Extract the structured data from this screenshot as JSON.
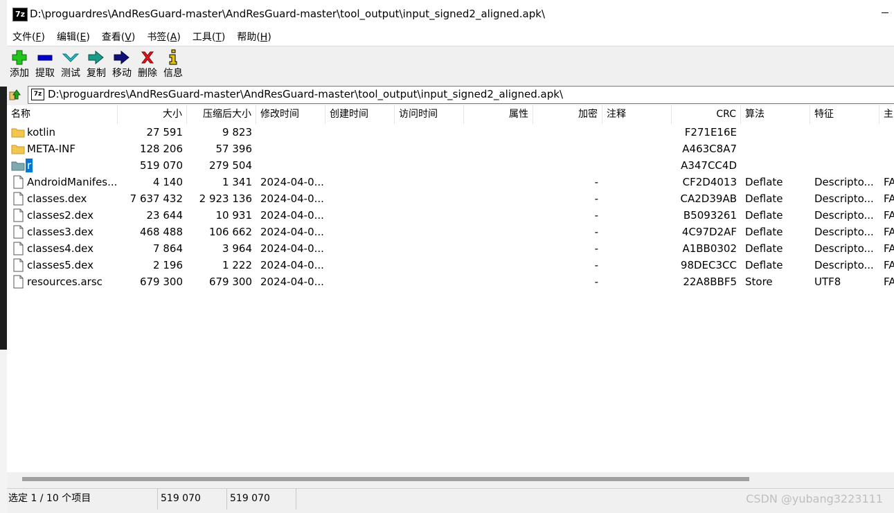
{
  "window": {
    "title": "D:\\proguardres\\AndResGuard-master\\AndResGuard-master\\tool_output\\input_signed2_aligned.apk\\",
    "icon_text": "7z"
  },
  "menu": [
    {
      "text": "文件(",
      "key": "F",
      "end": ")"
    },
    {
      "text": "编辑(",
      "key": "E",
      "end": ")"
    },
    {
      "text": "查看(",
      "key": "V",
      "end": ")"
    },
    {
      "text": "书签(",
      "key": "A",
      "end": ")"
    },
    {
      "text": "工具(",
      "key": "T",
      "end": ")"
    },
    {
      "text": "帮助(",
      "key": "H",
      "end": ")"
    }
  ],
  "toolbar": {
    "add": "添加",
    "extract": "提取",
    "test": "测试",
    "copy": "复制",
    "move": "移动",
    "delete": "删除",
    "info": "信息",
    "colors": {
      "add": "#22c31c",
      "extract": "#0000cc",
      "test": "#22c4c9",
      "copy": "#1a9a8a",
      "move": "#10107a",
      "delete": "#e0151b",
      "info": "#e7c400"
    }
  },
  "address": {
    "path": "D:\\proguardres\\AndResGuard-master\\AndResGuard-master\\tool_output\\input_signed2_aligned.apk\\"
  },
  "columns": [
    "名称",
    "大小",
    "压缩后大小",
    "修改时间",
    "创建时间",
    "访问时间",
    "属性",
    "加密",
    "注释",
    "CRC",
    "算法",
    "特征",
    "主"
  ],
  "rows": [
    {
      "type": "folder",
      "name": "kotlin",
      "size": "27 591",
      "packed": "9 823",
      "modified": "",
      "encrypted": "",
      "crc": "F271E16E",
      "method": "",
      "character": "",
      "host": ""
    },
    {
      "type": "folder",
      "name": "META-INF",
      "size": "128 206",
      "packed": "57 396",
      "modified": "",
      "encrypted": "",
      "crc": "A463C8A7",
      "method": "",
      "character": "",
      "host": ""
    },
    {
      "type": "folder-selected",
      "name": "r",
      "size": "519 070",
      "packed": "279 504",
      "modified": "",
      "encrypted": "",
      "crc": "A347CC4D",
      "method": "",
      "character": "",
      "host": ""
    },
    {
      "type": "file",
      "name": "AndroidManifes...",
      "size": "4 140",
      "packed": "1 341",
      "modified": "2024-04-0...",
      "encrypted": "-",
      "crc": "CF2D4013",
      "method": "Deflate",
      "character": "Descripto...",
      "host": "FA"
    },
    {
      "type": "file",
      "name": "classes.dex",
      "size": "7 637 432",
      "packed": "2 923 136",
      "modified": "2024-04-0...",
      "encrypted": "-",
      "crc": "CA2D39AB",
      "method": "Deflate",
      "character": "Descripto...",
      "host": "FA"
    },
    {
      "type": "file",
      "name": "classes2.dex",
      "size": "23 644",
      "packed": "10 931",
      "modified": "2024-04-0...",
      "encrypted": "-",
      "crc": "B5093261",
      "method": "Deflate",
      "character": "Descripto...",
      "host": "FA"
    },
    {
      "type": "file",
      "name": "classes3.dex",
      "size": "468 488",
      "packed": "106 662",
      "modified": "2024-04-0...",
      "encrypted": "-",
      "crc": "4C97D2AF",
      "method": "Deflate",
      "character": "Descripto...",
      "host": "FA"
    },
    {
      "type": "file",
      "name": "classes4.dex",
      "size": "7 864",
      "packed": "3 964",
      "modified": "2024-04-0...",
      "encrypted": "-",
      "crc": "A1BB0302",
      "method": "Deflate",
      "character": "Descripto...",
      "host": "FA"
    },
    {
      "type": "file",
      "name": "classes5.dex",
      "size": "2 196",
      "packed": "1 222",
      "modified": "2024-04-0...",
      "encrypted": "-",
      "crc": "98DEC3CC",
      "method": "Deflate",
      "character": "Descripto...",
      "host": "FA"
    },
    {
      "type": "file",
      "name": "resources.arsc",
      "size": "679 300",
      "packed": "679 300",
      "modified": "2024-04-0...",
      "encrypted": "-",
      "crc": "22A8BBF5",
      "method": "Store",
      "character": "UTF8",
      "host": "FA"
    }
  ],
  "status": {
    "selection": "选定 1 / 10 个项目",
    "size": "519 070",
    "packed": "519 070"
  },
  "watermark": "CSDN @yubang3223111"
}
